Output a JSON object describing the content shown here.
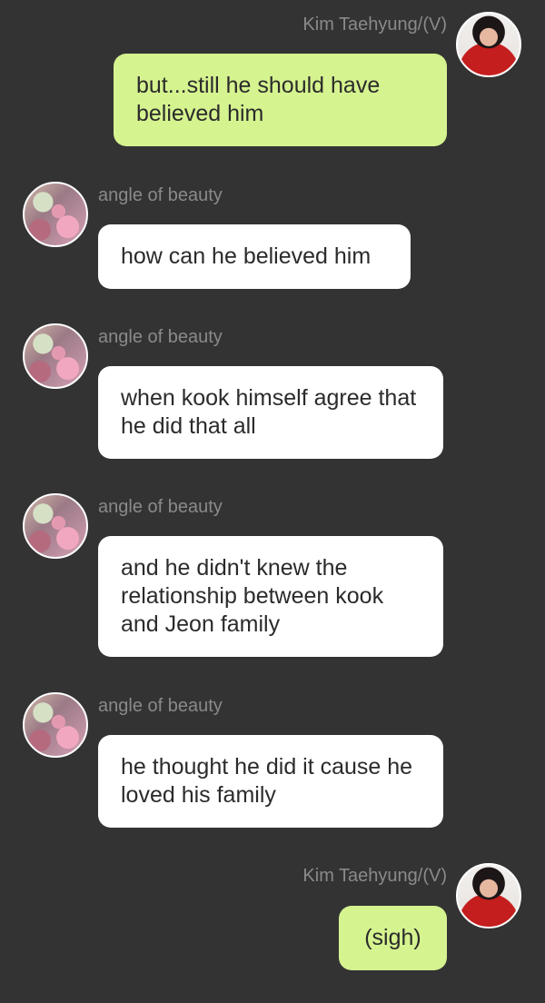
{
  "messages": [
    {
      "sender": "Kim Taehyung/(V)",
      "text": "but...still he should have believed him",
      "direction": "outgoing"
    },
    {
      "sender": "angle of beauty",
      "text": "how can he believed him",
      "direction": "incoming"
    },
    {
      "sender": "angle of beauty",
      "text": "when kook himself agree that he did that all",
      "direction": "incoming"
    },
    {
      "sender": "angle of beauty",
      "text": "and he didn't knew the relationship between kook and Jeon family",
      "direction": "incoming"
    },
    {
      "sender": "angle of beauty",
      "text": "he thought he did it cause he loved his family",
      "direction": "incoming"
    },
    {
      "sender": "Kim Taehyung/(V)",
      "text": "(sigh)",
      "direction": "outgoing"
    }
  ],
  "colors": {
    "background": "#333333",
    "outgoing_bubble": "#d5f38f",
    "incoming_bubble": "#ffffff",
    "sender_name": "#8a8a8a"
  }
}
